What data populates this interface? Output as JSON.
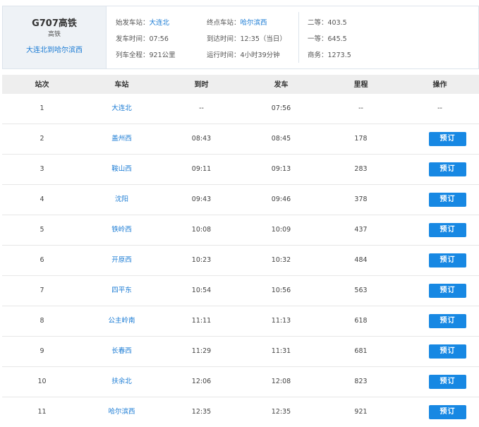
{
  "train": {
    "code": "G707高铁",
    "type": "高铁",
    "route": "大连北到哈尔滨西"
  },
  "info": {
    "start_station_label": "始发车站：",
    "start_station": "大连北",
    "end_station_label": "终点车站：",
    "end_station": "哈尔滨西",
    "depart_label": "发车时间：",
    "depart_time": "07:56",
    "arrive_label": "到达时间：",
    "arrive_time": "12:35（当日）",
    "distance_label": "列车全程：",
    "distance": "921公里",
    "duration_label": "运行时间：",
    "duration": "4小时39分钟"
  },
  "fares": [
    {
      "label": "二等：",
      "price": "403.5"
    },
    {
      "label": "一等：",
      "price": "645.5"
    },
    {
      "label": "商务：",
      "price": "1273.5"
    }
  ],
  "table": {
    "headers": [
      "站次",
      "车站",
      "到时",
      "发车",
      "里程",
      "操作"
    ],
    "book_label": "预订",
    "rows": [
      {
        "no": "1",
        "station": "大连北",
        "arrive": "--",
        "depart": "07:56",
        "mileage": "--",
        "action": "--"
      },
      {
        "no": "2",
        "station": "盖州西",
        "arrive": "08:43",
        "depart": "08:45",
        "mileage": "178"
      },
      {
        "no": "3",
        "station": "鞍山西",
        "arrive": "09:11",
        "depart": "09:13",
        "mileage": "283"
      },
      {
        "no": "4",
        "station": "沈阳",
        "arrive": "09:43",
        "depart": "09:46",
        "mileage": "378"
      },
      {
        "no": "5",
        "station": "铁岭西",
        "arrive": "10:08",
        "depart": "10:09",
        "mileage": "437"
      },
      {
        "no": "6",
        "station": "开原西",
        "arrive": "10:23",
        "depart": "10:32",
        "mileage": "484"
      },
      {
        "no": "7",
        "station": "四平东",
        "arrive": "10:54",
        "depart": "10:56",
        "mileage": "563"
      },
      {
        "no": "8",
        "station": "公主岭南",
        "arrive": "11:11",
        "depart": "11:13",
        "mileage": "618"
      },
      {
        "no": "9",
        "station": "长春西",
        "arrive": "11:29",
        "depart": "11:31",
        "mileage": "681"
      },
      {
        "no": "10",
        "station": "扶余北",
        "arrive": "12:06",
        "depart": "12:08",
        "mileage": "823"
      },
      {
        "no": "11",
        "station": "哈尔滨西",
        "arrive": "12:35",
        "depart": "12:35",
        "mileage": "921"
      }
    ]
  },
  "colors": {
    "link": "#1a7bd4",
    "button": "#1788e3",
    "header_bg": "#eeeeee",
    "panel_bg": "#eef2f6"
  }
}
